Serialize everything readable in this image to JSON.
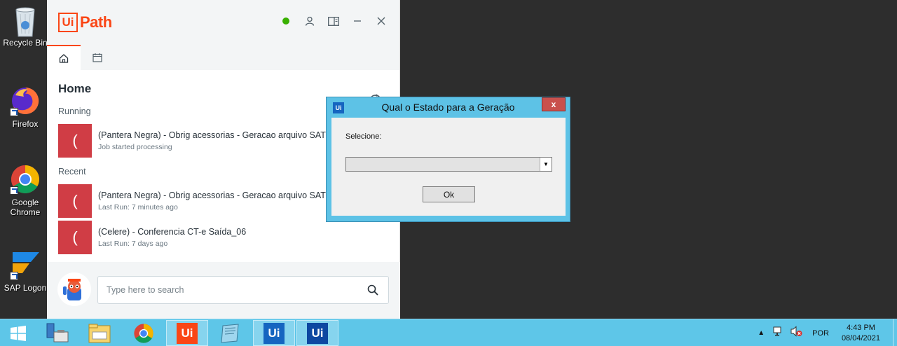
{
  "desktop": {
    "icons": [
      {
        "label": "Recycle Bin"
      },
      {
        "label": "Firefox"
      },
      {
        "label": "Google Chrome"
      },
      {
        "label": "SAP Logon"
      }
    ]
  },
  "assistant": {
    "logo_ui": "Ui",
    "logo_path": "Path",
    "status_color": "#38b000",
    "home_title": "Home",
    "running_label": "Running",
    "recent_label": "Recent",
    "running_jobs": [
      {
        "thumb": "(",
        "name": "(Pantera Negra) - Obrig acessorias - Geracao arquivo SATI",
        "sub": "Job started processing"
      }
    ],
    "recent_jobs": [
      {
        "thumb": "(",
        "name": "(Pantera Negra) - Obrig acessorias - Geracao arquivo SATI",
        "sub": "Last Run: 7 minutes ago"
      },
      {
        "thumb": "(",
        "name": "(Celere) - Conferencia CT-e Saída_06",
        "sub": "Last Run: 7 days ago"
      }
    ],
    "search_placeholder": "Type here to search",
    "accent_color": "#fa4616"
  },
  "dialog": {
    "icon": "Ui",
    "title": "Qual o Estado para a Geração",
    "close": "x",
    "label": "Selecione:",
    "combo_value": "",
    "ok_label": "Ok"
  },
  "taskbar": {
    "language": "POR",
    "time": "4:43 PM",
    "date": "08/04/2021",
    "apps": [
      "server-manager",
      "file-explorer",
      "chrome",
      "uipath-studio",
      "notepad",
      "uipath-assistant",
      "uipath-robot"
    ]
  }
}
